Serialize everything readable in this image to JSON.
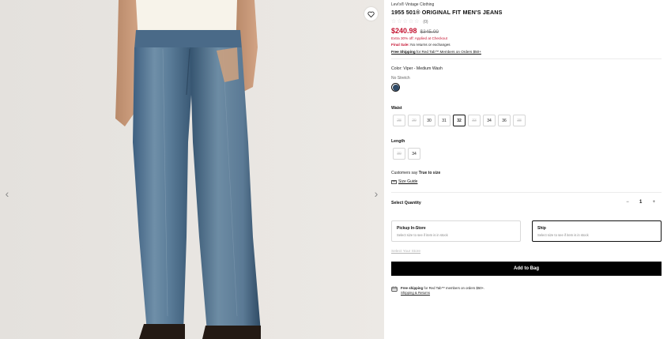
{
  "gallery": {
    "prev_arrow": "‹",
    "next_arrow": "›",
    "favorite_icon": "heart-icon"
  },
  "product": {
    "brand": "Levi's® Vintage Clothing",
    "title": "1955 501® ORIGINAL FIT MEN'S JEANS",
    "rating_stars": [
      "☆",
      "☆",
      "☆",
      "☆",
      "☆"
    ],
    "rating_count": "(0)",
    "sale_price": "$240.98",
    "original_price": "$345.00",
    "promo": "Extra 30% off: Applied at Checkout",
    "final_sale_label": "Final Sale:",
    "final_sale_text": "No returns or exchanges",
    "free_ship_bold": "Free Shipping",
    "free_ship_text": "for Red Tab™ Members on Orders $50+",
    "color_label": "Color:",
    "color_value": "Viper - Medium Wash",
    "stretch": "No Stretch",
    "swatch_color": "#2f4a66"
  },
  "waist": {
    "label": "Waist",
    "sizes": [
      {
        "value": "28",
        "available": false
      },
      {
        "value": "29",
        "available": false
      },
      {
        "value": "30",
        "available": true
      },
      {
        "value": "31",
        "available": true
      },
      {
        "value": "32",
        "available": true,
        "selected": true
      },
      {
        "value": "33",
        "available": false
      },
      {
        "value": "34",
        "available": true
      },
      {
        "value": "36",
        "available": true
      },
      {
        "value": "38",
        "available": false
      }
    ]
  },
  "length": {
    "label": "Length",
    "sizes": [
      {
        "value": "30",
        "available": false
      },
      {
        "value": "34",
        "available": true
      }
    ]
  },
  "fit": {
    "prefix": "Customers say",
    "value": "True to size",
    "size_guide": "Size Guide"
  },
  "quantity": {
    "label": "Select Quantity",
    "minus": "−",
    "value": "1",
    "plus": "+"
  },
  "fulfillment": {
    "pickup_title": "Pickup In-Store",
    "pickup_sub": "Select size to see if item is in stock",
    "ship_title": "Ship",
    "ship_sub": "Select size to see if item is in stock",
    "select_store": "Select Your Store"
  },
  "cta": {
    "add_to_bag": "Add to Bag"
  },
  "shipping_info": {
    "bold": "Free shipping",
    "text": "for Red Tab™ members on orders $50+.",
    "link": "Shipping & Returns"
  },
  "colors": {
    "sale_red": "#c41230",
    "button_black": "#000000"
  }
}
